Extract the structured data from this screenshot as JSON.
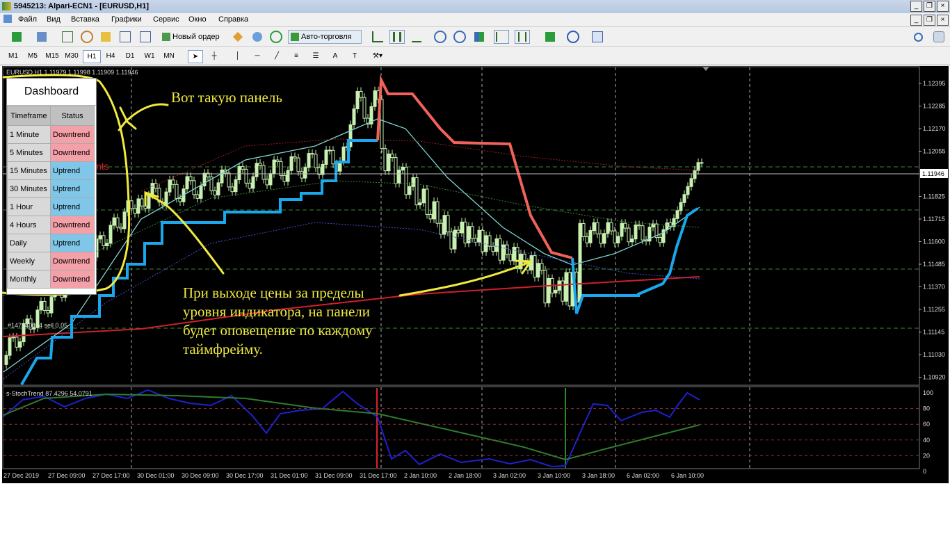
{
  "window": {
    "title": "5945213: Alpari-ECN1 - [EURUSD,H1]",
    "min": "_",
    "restore": "❐",
    "close": "×"
  },
  "menu": [
    "Файл",
    "Вид",
    "Вставка",
    "Графики",
    "Сервис",
    "Окно",
    "Справка"
  ],
  "toolbar": {
    "new_order": "Новый ордер",
    "auto_trading": "Авто-торговля"
  },
  "timeframes": [
    "M1",
    "M5",
    "M15",
    "M30",
    "H1",
    "H4",
    "D1",
    "W1",
    "MN"
  ],
  "active_timeframe": "H1",
  "chart": {
    "header": "EURUSD,H1  1.11979 1.11998 1.11909 1.11946",
    "current_price": "1.11946",
    "price_ticks": [
      "1.12395",
      "1.12285",
      "1.12170",
      "1.12055",
      "1.11946",
      "1.11825",
      "1.11715",
      "1.11600",
      "1.11485",
      "1.11370",
      "1.11255",
      "1.11145",
      "1.11030",
      "1.10920"
    ],
    "order_label": "#147340024 sell 0.05",
    "points_label": "nts",
    "time_ticks": [
      "27 Dec 2019",
      "27 Dec 09:00",
      "27 Dec 17:00",
      "30 Dec 01:00",
      "30 Dec 09:00",
      "30 Dec 17:00",
      "31 Dec 01:00",
      "31 Dec 09:00",
      "31 Dec 17:00",
      "2 Jan 10:00",
      "2 Jan 18:00",
      "3 Jan 02:00",
      "3 Jan 10:00",
      "3 Jan 18:00",
      "6 Jan 02:00",
      "6 Jan 10:00"
    ],
    "indicator_label": "s-StochTrend 87.4296 54.0791",
    "indicator_ticks": [
      "100",
      "80",
      "60",
      "40",
      "20",
      "0"
    ],
    "colors": {
      "bg": "#000000",
      "up_trend": "#1aa7ec",
      "down_trend": "#f0625a",
      "ma_red": "#d0202a",
      "ma_cyan": "#7fd6d0",
      "stoch_blue": "#2020d0",
      "stoch_green": "#2e7d2e",
      "annotation": "#f0ea40"
    }
  },
  "dashboard": {
    "title": "Dashboard",
    "headers": [
      "Timeframe",
      "Status"
    ],
    "rows": [
      {
        "tf": "1 Minute",
        "status": "Downtrend"
      },
      {
        "tf": "5 Minutes",
        "status": "Downtrend"
      },
      {
        "tf": "15 Minutes",
        "status": "Uptrend"
      },
      {
        "tf": "30 Minutes",
        "status": "Uptrend"
      },
      {
        "tf": "1 Hour",
        "status": "Uptrend"
      },
      {
        "tf": "4 Hours",
        "status": "Downtrend"
      },
      {
        "tf": "Daily",
        "status": "Uptrend"
      },
      {
        "tf": "Weekly",
        "status": "Downtrend"
      },
      {
        "tf": "Monthly",
        "status": "Downtrend"
      }
    ]
  },
  "annotations": {
    "panel_note": "Вот такую панель",
    "alert_note": "При выходе цены за пределы уровня индикатора, на панели будет оповещение по каждому таймфрейму."
  }
}
